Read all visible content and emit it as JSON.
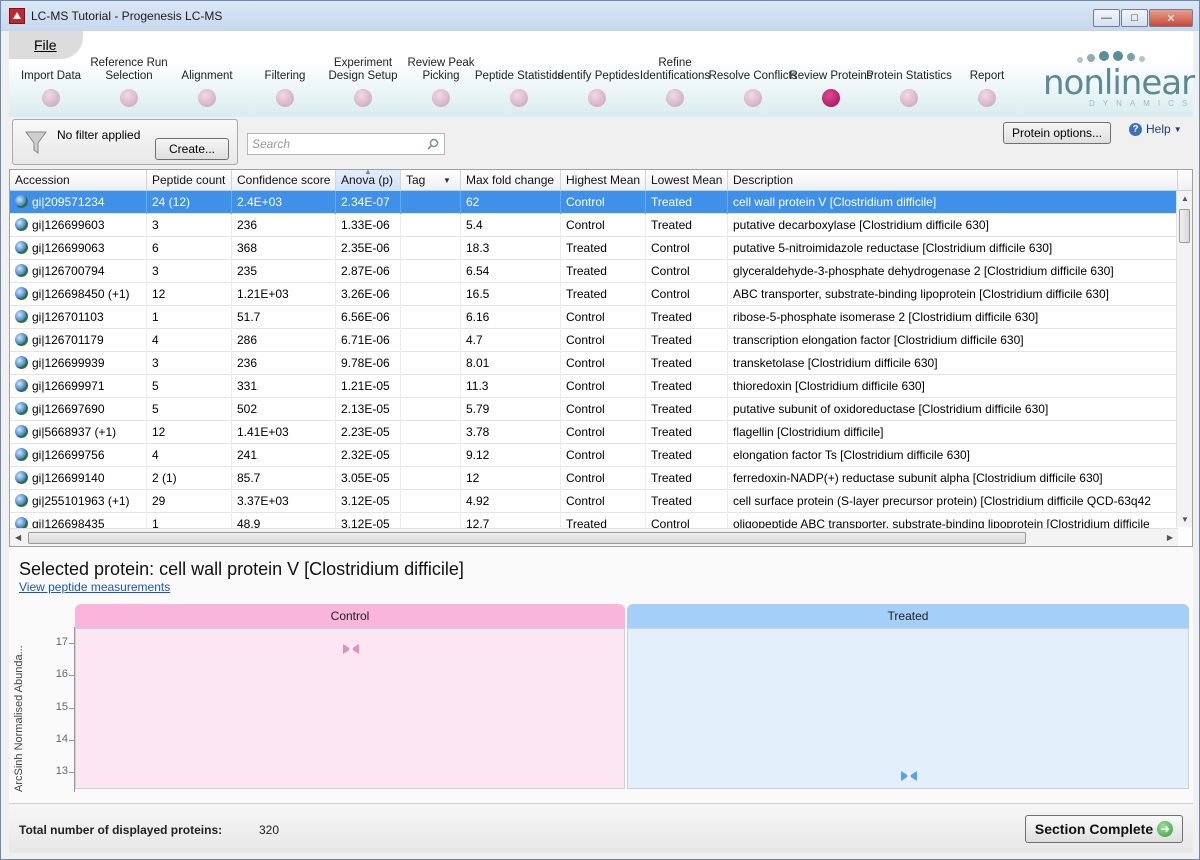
{
  "window": {
    "title": "LC-MS Tutorial - Progenesis LC-MS"
  },
  "menu": {
    "file_label": "File"
  },
  "workflow": {
    "steps": [
      {
        "label": "Import Data",
        "active": false
      },
      {
        "label": "Reference Run Selection",
        "active": false
      },
      {
        "label": "Alignment",
        "active": false
      },
      {
        "label": "Filtering",
        "active": false
      },
      {
        "label": "Experiment Design Setup",
        "active": false
      },
      {
        "label": "Review Peak Picking",
        "active": false
      },
      {
        "label": "Peptide Statistics",
        "active": false
      },
      {
        "label": "Identify Peptides",
        "active": false
      },
      {
        "label": "Refine Identifications",
        "active": false
      },
      {
        "label": "Resolve Conflicts",
        "active": false
      },
      {
        "label": "Review Proteins",
        "active": true
      },
      {
        "label": "Protein Statistics",
        "active": false
      },
      {
        "label": "Report",
        "active": false
      }
    ]
  },
  "logo": {
    "word": "nonlinear",
    "sub": "DYNAMICS"
  },
  "filter": {
    "status": "No filter applied",
    "create_label": "Create..."
  },
  "search": {
    "placeholder": "Search"
  },
  "toolbar": {
    "protein_options_label": "Protein options...",
    "help_label": "Help"
  },
  "table": {
    "columns": [
      "Accession",
      "Peptide count",
      "Confidence score",
      "Anova (p)",
      "Tag",
      "Max fold change",
      "Highest Mean",
      "Lowest Mean",
      "Description"
    ],
    "rows": [
      [
        "gi|209571234",
        "24 (12)",
        "2.4E+03",
        "2.34E-07",
        "",
        "62",
        "Control",
        "Treated",
        "cell wall protein V [Clostridium difficile]"
      ],
      [
        "gi|126699603",
        "3",
        "236",
        "1.33E-06",
        "",
        "5.4",
        "Control",
        "Treated",
        "putative decarboxylase [Clostridium difficile 630]"
      ],
      [
        "gi|126699063",
        "6",
        "368",
        "2.35E-06",
        "",
        "18.3",
        "Treated",
        "Control",
        "putative 5-nitroimidazole reductase [Clostridium difficile 630]"
      ],
      [
        "gi|126700794",
        "3",
        "235",
        "2.87E-06",
        "",
        "6.54",
        "Treated",
        "Control",
        "glyceraldehyde-3-phosphate dehydrogenase 2 [Clostridium difficile 630]"
      ],
      [
        "gi|126698450 (+1)",
        "12",
        "1.21E+03",
        "3.26E-06",
        "",
        "16.5",
        "Treated",
        "Control",
        "ABC transporter, substrate-binding lipoprotein [Clostridium difficile 630]"
      ],
      [
        "gi|126701103",
        "1",
        "51.7",
        "6.56E-06",
        "",
        "6.16",
        "Control",
        "Treated",
        "ribose-5-phosphate isomerase 2 [Clostridium difficile 630]"
      ],
      [
        "gi|126701179",
        "4",
        "286",
        "6.71E-06",
        "",
        "4.7",
        "Control",
        "Treated",
        "transcription elongation factor [Clostridium difficile 630]"
      ],
      [
        "gi|126699939",
        "3",
        "236",
        "9.78E-06",
        "",
        "8.01",
        "Control",
        "Treated",
        "transketolase [Clostridium difficile 630]"
      ],
      [
        "gi|126699971",
        "5",
        "331",
        "1.21E-05",
        "",
        "11.3",
        "Control",
        "Treated",
        "thioredoxin [Clostridium difficile 630]"
      ],
      [
        "gi|126697690",
        "5",
        "502",
        "2.13E-05",
        "",
        "5.79",
        "Control",
        "Treated",
        "putative subunit of oxidoreductase [Clostridium difficile 630]"
      ],
      [
        "gi|5668937 (+1)",
        "12",
        "1.41E+03",
        "2.23E-05",
        "",
        "3.78",
        "Control",
        "Treated",
        "flagellin [Clostridium difficile]"
      ],
      [
        "gi|126699756",
        "4",
        "241",
        "2.32E-05",
        "",
        "9.12",
        "Control",
        "Treated",
        "elongation factor Ts [Clostridium difficile 630]"
      ],
      [
        "gi|126699140",
        "2 (1)",
        "85.7",
        "3.05E-05",
        "",
        "12",
        "Control",
        "Treated",
        "ferredoxin-NADP(+) reductase subunit alpha [Clostridium difficile 630]"
      ],
      [
        "gi|255101963 (+1)",
        "29",
        "3.37E+03",
        "3.12E-05",
        "",
        "4.92",
        "Control",
        "Treated",
        "cell surface protein (S-layer precursor protein) [Clostridium difficile QCD-63q42"
      ],
      [
        "gi|126698435",
        "1",
        "48.9",
        "3.12E-05",
        "",
        "12.7",
        "Treated",
        "Control",
        "oligopeptide ABC transporter, substrate-binding lipoprotein [Clostridium difficile"
      ]
    ],
    "selected_row": 0
  },
  "detail": {
    "selected_title": "Selected protein: cell wall protein V [Clostridium difficile]",
    "view_link": "View peptide measurements",
    "y_axis_label": "ArcSinh Normalised Abunda...",
    "y_ticks": [
      "17",
      "16",
      "15",
      "14",
      "13"
    ],
    "groups": [
      {
        "name": "Control",
        "value": 16.9,
        "header_color": "#f9b5dc",
        "body_color": "#fbe6f1",
        "marker_color": "#e48fbf"
      },
      {
        "name": "Treated",
        "value": 12.98,
        "header_color": "#a4cff8",
        "body_color": "#e3effb",
        "marker_color": "#5aa2e6"
      }
    ]
  },
  "status": {
    "total_label": "Total number of displayed proteins:",
    "total_value": "320",
    "section_complete_label": "Section Complete"
  }
}
